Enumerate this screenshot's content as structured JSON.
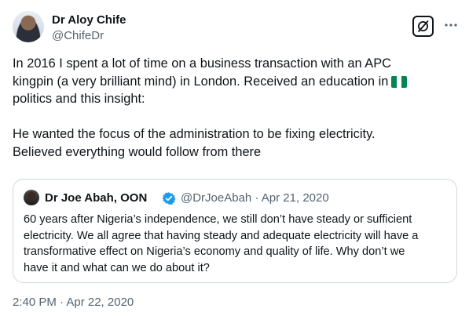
{
  "author": {
    "name": "Dr Aloy Chife",
    "handle": "@ChifeDr"
  },
  "tweet": {
    "line1": "In 2016 I spent a lot of time on a business transaction with an APC",
    "line2": "kingpin (a very brilliant mind) in London. Received an education in",
    "line3": "politics and this insight:",
    "line4": "He wanted the focus of the administration to be fixing electricity.",
    "line5": "Believed everything would follow from there",
    "flag_icon": "nigeria-flag-icon"
  },
  "quoted_tweet": {
    "name": "Dr Joe Abah, OON",
    "verified_icon": "verified-badge-icon",
    "handle": "@DrJoeAbah",
    "separator": "·",
    "date": "Apr 21, 2020",
    "line1": "60 years after Nigeria’s independence, we still don’t have steady or sufficient",
    "line2": "electricity. We all agree that having steady and adequate electricity will have a",
    "line3": "transformative effect on Nigeria’s economy and quality of life. Why don’t we",
    "line4": "have it and what can we do about it?"
  },
  "timestamp": "2:40 PM · Apr 22, 2020",
  "icons": {
    "grok": "grok-icon",
    "more": "more-options-icon"
  },
  "colors": {
    "text_primary": "#0f1419",
    "text_secondary": "#536471",
    "border": "#cfd9de",
    "verified_blue": "#1d9bf0",
    "flag_green": "#008751"
  }
}
